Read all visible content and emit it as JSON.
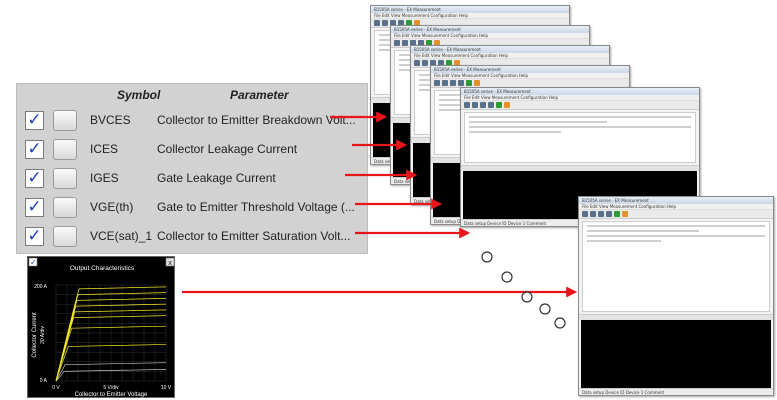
{
  "table": {
    "header_symbol": "Symbol",
    "header_parameter": "Parameter",
    "rows": [
      {
        "symbol": "BVCES",
        "parameter": "Collector to Emitter Breakdown Volt...",
        "checked": true
      },
      {
        "symbol": "ICES",
        "parameter": "Collector Leakage Current",
        "checked": true
      },
      {
        "symbol": "IGES",
        "parameter": "Gate Leakage Current",
        "checked": true
      },
      {
        "symbol": "VGE(th)",
        "parameter": "Gate to Emitter Threshold Voltage (...",
        "checked": true
      },
      {
        "symbol": "VCE(sat)_1",
        "parameter": "Collector to Emitter Saturation Volt...",
        "checked": true
      }
    ]
  },
  "plot": {
    "title": "Output Characteristics",
    "xlabel": "Collector to Emitter Voltage",
    "ylabel": "Collector Current",
    "tick_x0": "0 V",
    "tick_xmid": "5 V/div",
    "tick_x1": "10 V",
    "tick_y1": "200 A",
    "tick_ymid": "20 A/div",
    "tick_y0": "0 A",
    "checkbox_mark": "✓",
    "close_mark": "x"
  },
  "windows": {
    "title": "B1505A series - EX Measurement",
    "menu": "File  Edit  View  Measurement  Configuration  Help",
    "footer": "Data setup  Device ID  Device 1      Comment"
  },
  "colors": {
    "arrow": "#e8161a",
    "check": "#1c3fbf",
    "curve": "#f4e82a",
    "curve_gray": "#c8c8c8"
  }
}
